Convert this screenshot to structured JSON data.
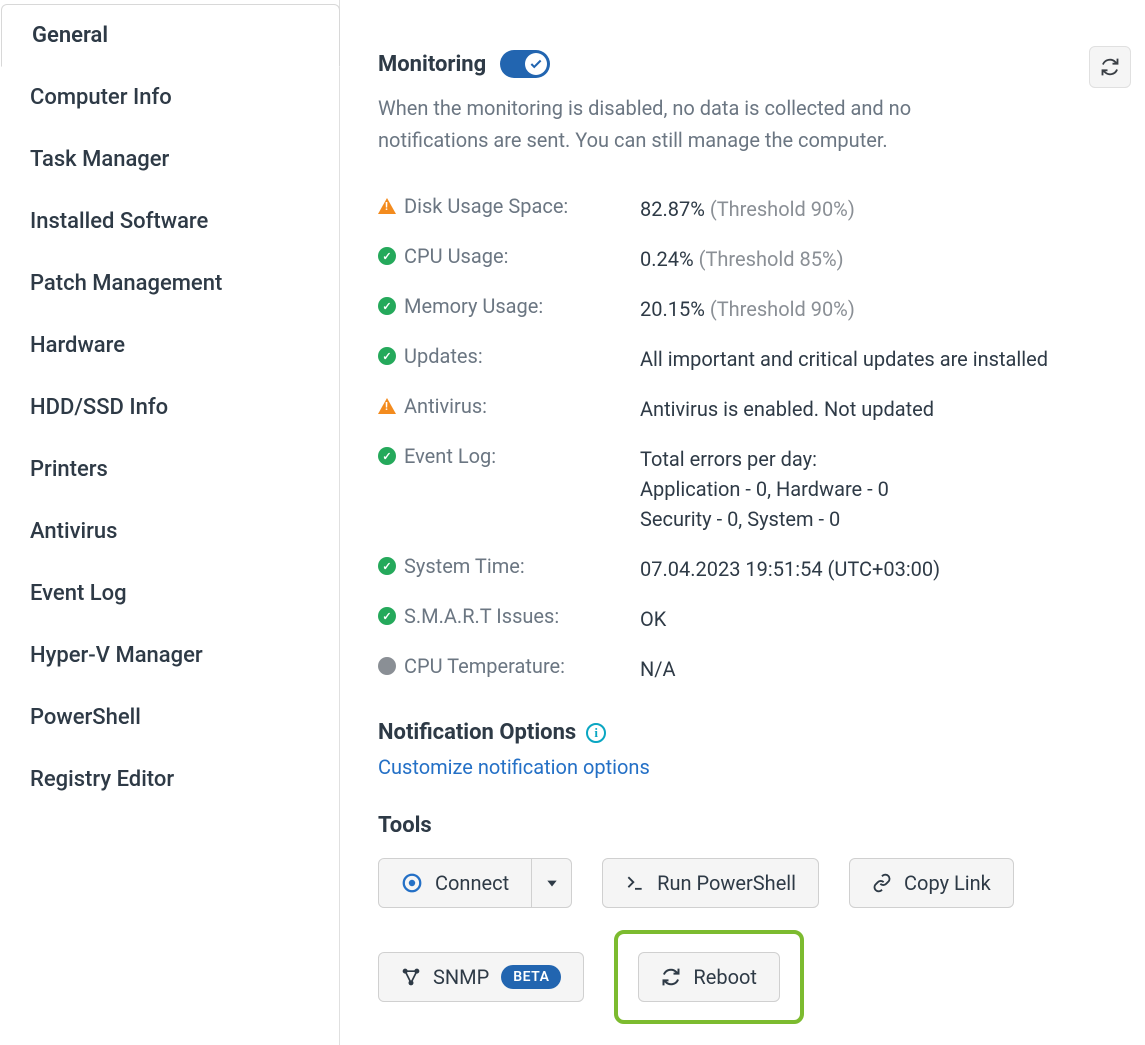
{
  "sidebar": {
    "tabs": [
      {
        "label": "General",
        "active": true
      },
      {
        "label": "Computer Info"
      },
      {
        "label": "Task Manager"
      },
      {
        "label": "Installed Software"
      },
      {
        "label": "Patch Management"
      },
      {
        "label": "Hardware"
      },
      {
        "label": "HDD/SSD Info"
      },
      {
        "label": "Printers"
      },
      {
        "label": "Antivirus"
      },
      {
        "label": "Event Log"
      },
      {
        "label": "Hyper-V Manager"
      },
      {
        "label": "PowerShell"
      },
      {
        "label": "Registry Editor"
      }
    ]
  },
  "monitoring": {
    "title": "Monitoring",
    "toggle_on": true,
    "subtext": "When the monitoring is disabled, no data is collected and no notifications are sent. You can still manage the computer."
  },
  "metrics": [
    {
      "status": "warn",
      "label": "Disk Usage Space:",
      "value": "82.87%",
      "threshold": "(Threshold 90%)"
    },
    {
      "status": "ok",
      "label": "CPU Usage:",
      "value": "0.24%",
      "threshold": "(Threshold 85%)"
    },
    {
      "status": "ok",
      "label": "Memory Usage:",
      "value": "20.15%",
      "threshold": "(Threshold 90%)"
    },
    {
      "status": "ok",
      "label": "Updates:",
      "value": "All important and critical updates are installed"
    },
    {
      "status": "warn",
      "label": "Antivirus:",
      "value": "Antivirus is enabled. Not updated"
    },
    {
      "status": "ok",
      "label": "Event Log:",
      "value_lines": [
        "Total errors per day:",
        "Application - 0, Hardware - 0",
        "Security - 0, System - 0"
      ]
    },
    {
      "status": "ok",
      "label": "System Time:",
      "value": "07.04.2023 19:51:54 (UTC+03:00)"
    },
    {
      "status": "ok",
      "label": "S.M.A.R.T Issues:",
      "value": "OK"
    },
    {
      "status": "na",
      "label": "CPU Temperature:",
      "value": "N/A"
    }
  ],
  "notifications": {
    "title": "Notification Options",
    "link": "Customize notification options"
  },
  "tools": {
    "title": "Tools",
    "connect": "Connect",
    "run_ps": "Run PowerShell",
    "copy_link": "Copy Link",
    "snmp": "SNMP",
    "beta": "BETA",
    "reboot": "Reboot"
  }
}
